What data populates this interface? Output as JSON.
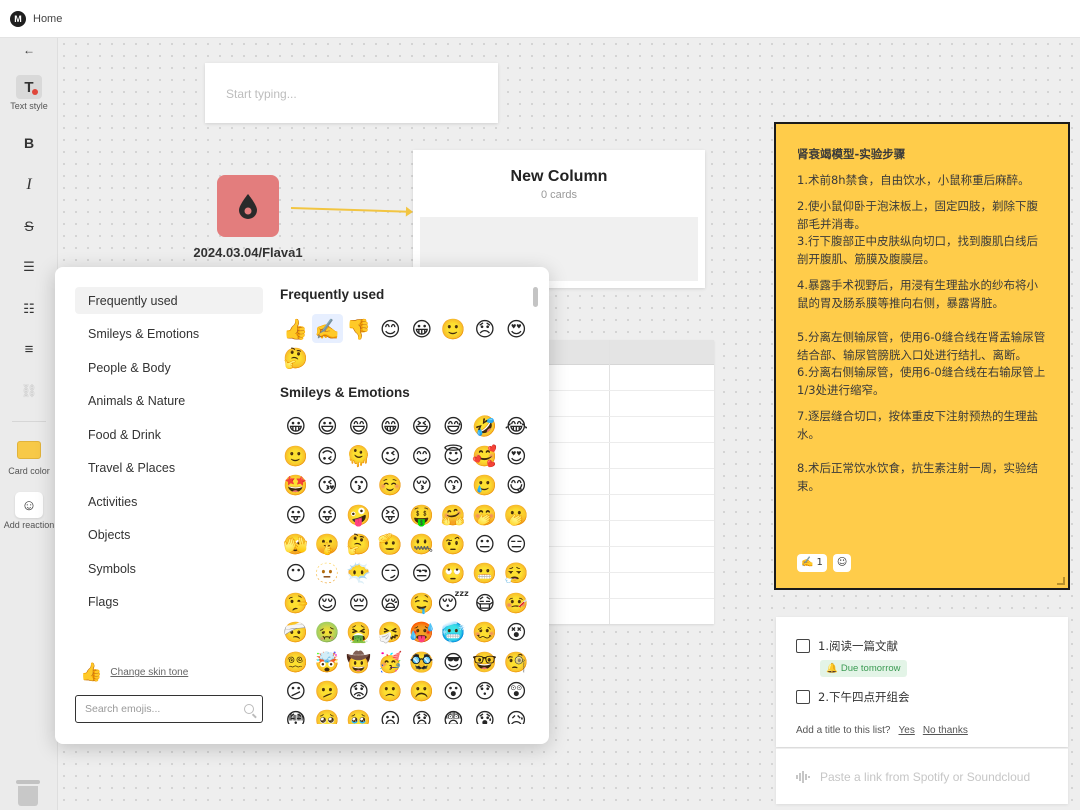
{
  "app": {
    "title": "Home",
    "logo": "M"
  },
  "toolbar": {
    "back": "←",
    "text_style": {
      "glyph": "T",
      "label": "Text style"
    },
    "bold": "B",
    "italic": "I",
    "strike": "S",
    "bullets": "☰",
    "numbered": "☷",
    "align": "≡",
    "link": "⛓",
    "card_color": {
      "label": "Card color",
      "color": "#f7c948"
    },
    "add_reaction": {
      "label": "Add reaction",
      "glyph": "☺"
    }
  },
  "canvas": {
    "note_input": {
      "placeholder": "Start typing..."
    },
    "board": {
      "label": "2024.03.04/Flava1",
      "color": "#e37d7d"
    },
    "column": {
      "title": "New Column",
      "count": "0 cards"
    }
  },
  "yellow_note": {
    "title": "肾衰竭模型-实验步骤",
    "steps": [
      "1.术前8h禁食，自由饮水，小鼠称重后麻醉。",
      "2.使小鼠仰卧于泡沫板上，固定四肢，剃除下腹部毛并消毒。",
      "3.行下腹部正中皮肤纵向切口，找到腹肌白线后剖开腹肌、筋膜及腹膜层。",
      "4.暴露手术视野后，用浸有生理盐水的纱布将小鼠的胃及肠系膜等推向右侧，暴露肾脏。",
      "5.分离左侧输尿管，使用6-0缝合线在肾盂输尿管结合部、输尿管膀胱入口处进行结扎、离断。",
      "6.分离右侧输尿管，使用6-0缝合线在右输尿管上1/3处进行缩窄。",
      "7.逐层缝合切口，按体重皮下注射预热的生理盐水。",
      "8.术后正常饮水饮食，抗生素注射一周，实验结束。"
    ],
    "reaction": {
      "emoji": "✍️",
      "count": "1"
    },
    "add_reaction_glyph": "☺"
  },
  "todo": {
    "items": [
      {
        "label": "1.阅读一篇文献"
      },
      {
        "label": "2.下午四点开组会"
      }
    ],
    "due_badge": "Due tomorrow",
    "title_prompt": "Add a title to this list?",
    "yes": "Yes",
    "no": "No thanks"
  },
  "spotify": {
    "placeholder": "Paste a link from Spotify or Soundcloud"
  },
  "emoji_picker": {
    "categories": [
      "Frequently used",
      "Smileys & Emotions",
      "People & Body",
      "Animals & Nature",
      "Food & Drink",
      "Travel & Places",
      "Activities",
      "Objects",
      "Symbols",
      "Flags"
    ],
    "active_category": "Frequently used",
    "skin_tone_label": "Change skin tone",
    "skin_tone_emoji": "👍",
    "search_placeholder": "Search emojis...",
    "sections": [
      {
        "title": "Frequently used",
        "emojis": [
          "👍",
          "✍️",
          "👎",
          "😊",
          "😀",
          "🙂",
          "😞",
          "😍",
          "🤔"
        ],
        "selected_index": 1
      },
      {
        "title": "Smileys & Emotions",
        "emojis": [
          "😀",
          "😃",
          "😄",
          "😁",
          "😆",
          "😅",
          "🤣",
          "😂",
          "🙂",
          "🙃",
          "🫠",
          "😉",
          "😊",
          "😇",
          "🥰",
          "😍",
          "🤩",
          "😘",
          "😗",
          "☺️",
          "😚",
          "😙",
          "🥲",
          "😋",
          "😛",
          "😜",
          "🤪",
          "😝",
          "🤑",
          "🤗",
          "🤭",
          "🫢",
          "🫣",
          "🤫",
          "🤔",
          "🫡",
          "🤐",
          "🤨",
          "😐",
          "😑",
          "😶",
          "🫥",
          "😶‍🌫️",
          "😏",
          "😒",
          "🙄",
          "😬",
          "😮‍💨",
          "🤥",
          "😌",
          "😔",
          "😪",
          "🤤",
          "😴",
          "😷",
          "🤒",
          "🤕",
          "🤢",
          "🤮",
          "🤧",
          "🥵",
          "🥶",
          "🥴",
          "😵",
          "😵‍💫",
          "🤯",
          "🤠",
          "🥳",
          "🥸",
          "😎",
          "🤓",
          "🧐",
          "😕",
          "🫤",
          "😟",
          "🙁",
          "☹️",
          "😮",
          "😯",
          "😲",
          "😳",
          "🥺",
          "🥹",
          "😦",
          "😧",
          "😨",
          "😰",
          "😥"
        ]
      }
    ]
  }
}
